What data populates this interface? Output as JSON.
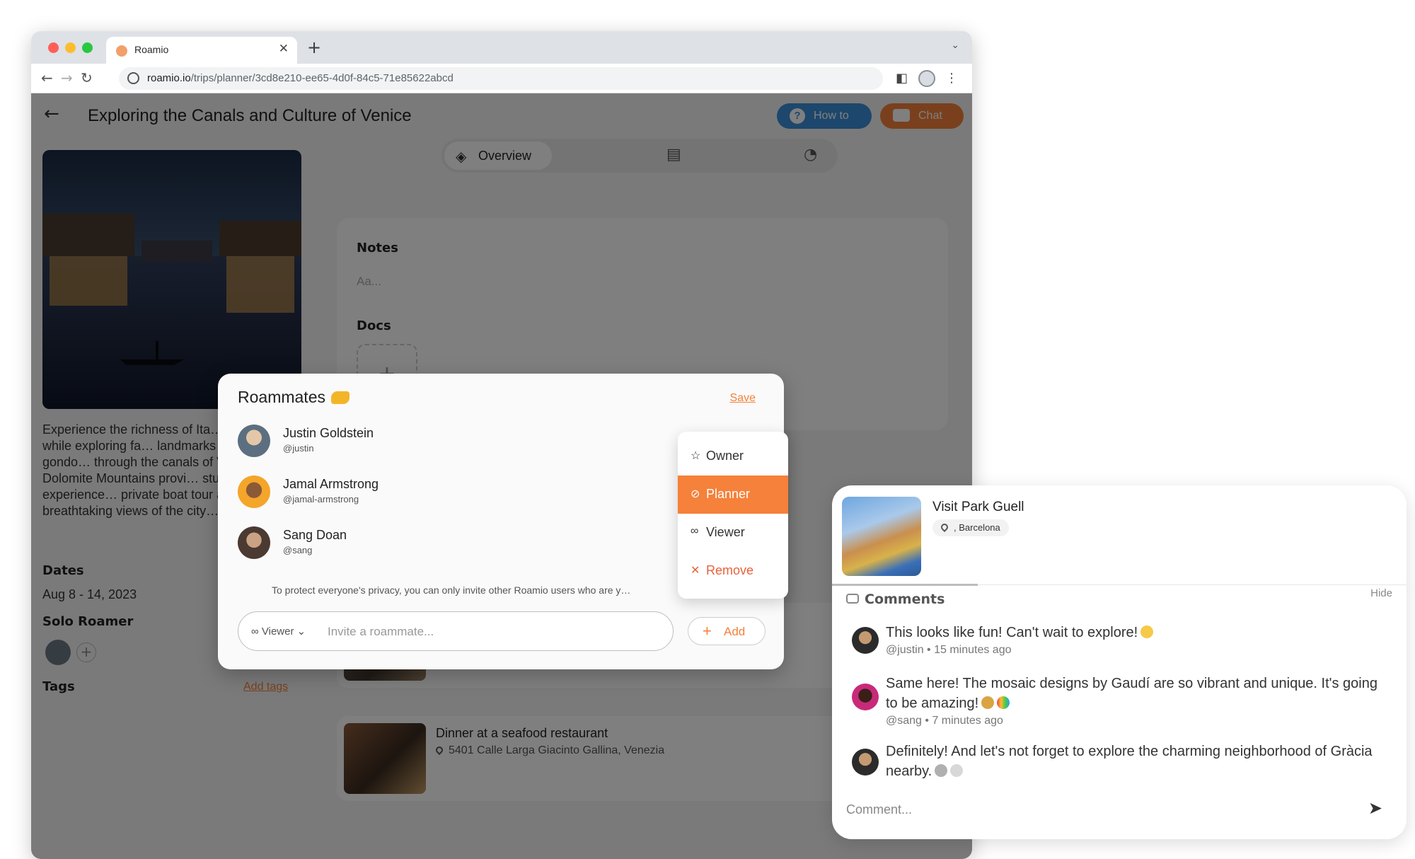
{
  "browser": {
    "tab_title": "Roamio",
    "url_host": "roamio.io",
    "url_path": "/trips/planner/3cd8e210-ee65-4d0f-84c5-71e85622abcd"
  },
  "page": {
    "title": "Exploring the Canals and Culture of Venice",
    "howto_label": "How to",
    "chat_label": "Chat",
    "tabs": {
      "overview_label": "Overview"
    },
    "description": "Experience the richness of Ita… and cuisine while exploring fa… landmarks and taking a gondo… through the canals of Venice. … the Dolomite Mountains provi… stunning outdoor experience… private boat tour and rooftop… breathtaking views of the city…",
    "dates_label": "Dates",
    "dates_value": "Aug 8 - 14, 2023",
    "solo_label": "Solo Roamer",
    "tags_label": "Tags",
    "add_tags_label": "Add tags",
    "notes_label": "Notes",
    "notes_placeholder": "Aa...",
    "docs_label": "Docs",
    "docs_add": "+",
    "activities": [
      {
        "title": "Dinner at a seafood restaurant",
        "location": "5401 Calle Larga Giacinto Gallina, Venezia"
      }
    ]
  },
  "dialog": {
    "title": "Roammates",
    "save_label": "Save",
    "roommates": [
      {
        "name": "Justin Goldstein",
        "handle": "@justin"
      },
      {
        "name": "Jamal Armstrong",
        "handle": "@jamal-armstrong"
      },
      {
        "name": "Sang Doan",
        "handle": "@sang"
      }
    ],
    "privacy_text": "To protect everyone's privacy, you can only invite other Roamio users who are y…",
    "invite_role": "Viewer",
    "invite_placeholder": "Invite a roammate...",
    "add_label": "Add"
  },
  "roles_menu": {
    "selected": "Planner",
    "items": [
      {
        "label": "Owner",
        "icon": "star-icon"
      },
      {
        "label": "Planner",
        "icon": "compass-icon"
      },
      {
        "label": "Viewer",
        "icon": "glasses-icon"
      },
      {
        "label": "Remove",
        "icon": "close-icon"
      }
    ]
  },
  "comments_panel": {
    "activity_title": "Visit Park Guell",
    "activity_location": ", Barcelona",
    "comments_label": "Comments",
    "hide_label": "Hide",
    "comments": [
      {
        "text": "This looks like fun! Can't wait to explore!",
        "handle": "@justin",
        "time": "15 minutes ago"
      },
      {
        "text": "Same here! The mosaic designs by Gaudí are so vibrant and unique. It's going to be amazing!",
        "handle": "@sang",
        "time": "7 minutes ago"
      },
      {
        "text": "Definitely! And let's not forget to explore the charming neighborhood of Gràcia nearby.",
        "handle": "",
        "time": ""
      }
    ],
    "input_placeholder": "Comment..."
  },
  "colors": {
    "accent": "#f5813a",
    "howto": "#3b8fd9"
  }
}
